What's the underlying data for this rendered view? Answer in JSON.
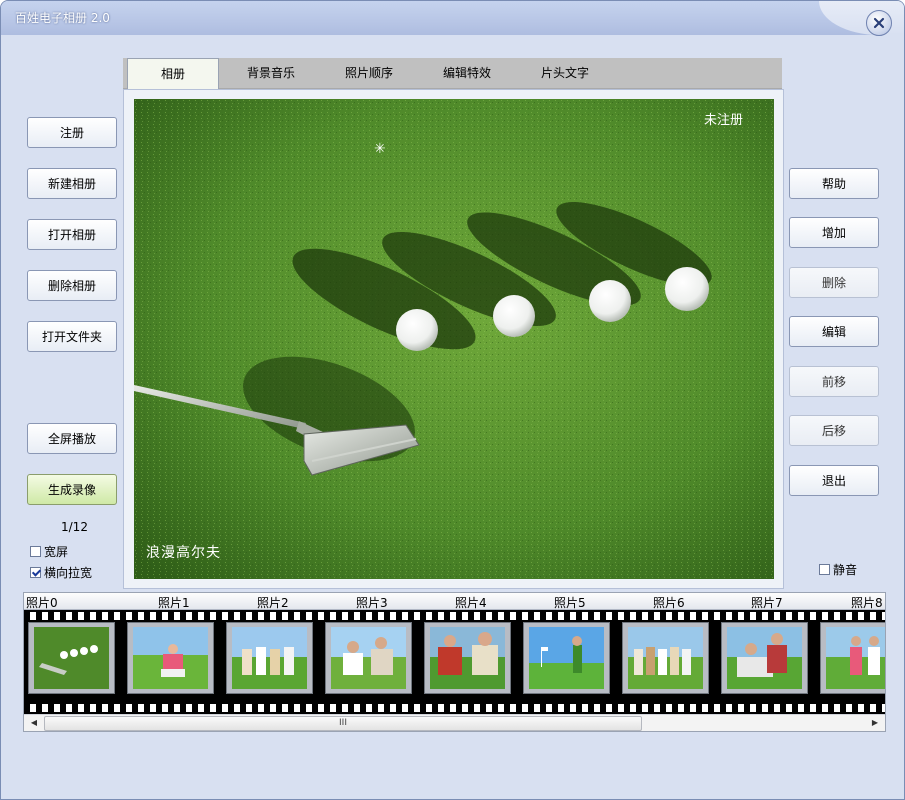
{
  "window": {
    "title": "百姓电子相册 2.0"
  },
  "tabs": [
    {
      "label": "相册",
      "active": true
    },
    {
      "label": "背景音乐",
      "active": false
    },
    {
      "label": "照片顺序",
      "active": false
    },
    {
      "label": "编辑特效",
      "active": false
    },
    {
      "label": "片头文字",
      "active": false
    }
  ],
  "photo": {
    "watermark": "未注册",
    "caption": "浪漫高尔夫",
    "sparkle": "✳"
  },
  "left_buttons": {
    "register": "注册",
    "new_album": "新建相册",
    "open_album": "打开相册",
    "delete_album": "删除相册",
    "open_folder": "打开文件夹",
    "fullscreen_play": "全屏播放",
    "generate_video": "生成录像"
  },
  "counter": "1/12",
  "checkboxes": {
    "widescreen": {
      "label": "宽屏",
      "checked": false
    },
    "horizontal_stretch": {
      "label": "横向拉宽",
      "checked": true
    },
    "mute": {
      "label": "静音",
      "checked": false
    }
  },
  "right_buttons": {
    "help": "帮助",
    "add": "增加",
    "delete": "删除",
    "edit": "编辑",
    "move_forward": "前移",
    "move_back": "后移",
    "exit": "退出"
  },
  "filmstrip": {
    "labels": [
      "照片0",
      "照片1",
      "照片2",
      "照片3",
      "照片4",
      "照片5",
      "照片6",
      "照片7",
      "照片8"
    ],
    "scroll_grip": "III",
    "left_arrow": "◀",
    "right_arrow": "▶"
  },
  "colors": {
    "window_bg": "#d8e0f1",
    "grass": "#4f8a2a",
    "green_button": "#cfe9a6"
  },
  "icons": {
    "close": "close-icon"
  }
}
